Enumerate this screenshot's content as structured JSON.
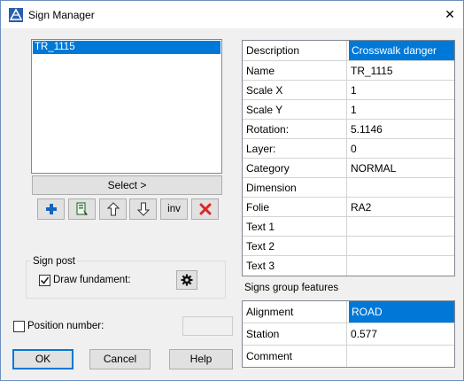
{
  "window": {
    "title": "Sign Manager",
    "close_glyph": "✕"
  },
  "sign_list": {
    "items": [
      "TR_1115"
    ],
    "selected": "TR_1115"
  },
  "select_button": "Select >",
  "toolbar": {
    "add_icon": "plus-icon",
    "edit_icon": "edit-sign-icon",
    "up_icon": "arrow-up-icon",
    "down_icon": "arrow-down-icon",
    "inv_label": "inv",
    "delete_icon": "delete-x-icon"
  },
  "sign_post": {
    "title": "Sign post",
    "draw_fundament": {
      "label": "Draw fundament:",
      "checked": true
    }
  },
  "position_number": {
    "label": "Position number:",
    "checked": false,
    "value": ""
  },
  "buttons": {
    "ok": "OK",
    "cancel": "Cancel",
    "help": "Help"
  },
  "properties": [
    {
      "key": "Description",
      "value": "Crosswalk danger",
      "selected": true
    },
    {
      "key": "Name",
      "value": "TR_1115"
    },
    {
      "key": "Scale X",
      "value": "1"
    },
    {
      "key": "Scale Y",
      "value": "1"
    },
    {
      "key": "Rotation:",
      "value": "5.1146"
    },
    {
      "key": "Layer:",
      "value": "0"
    },
    {
      "key": "Category",
      "value": "NORMAL"
    },
    {
      "key": "Dimension",
      "value": ""
    },
    {
      "key": "Folie",
      "value": "RA2"
    },
    {
      "key": "Text 1",
      "value": ""
    },
    {
      "key": "Text 2",
      "value": ""
    },
    {
      "key": "Text 3",
      "value": ""
    }
  ],
  "group_features": {
    "title": "Signs group features",
    "rows": [
      {
        "key": "Alignment",
        "value": "ROAD",
        "selected": true
      },
      {
        "key": "Station",
        "value": "0.577"
      },
      {
        "key": "Comment",
        "value": ""
      }
    ]
  },
  "colors": {
    "selection": "#0078d7",
    "button_face": "#e1e1e1",
    "dialog_bg": "#f0f0f0",
    "delete_red": "#e02424",
    "add_blue": "#1565c0"
  }
}
